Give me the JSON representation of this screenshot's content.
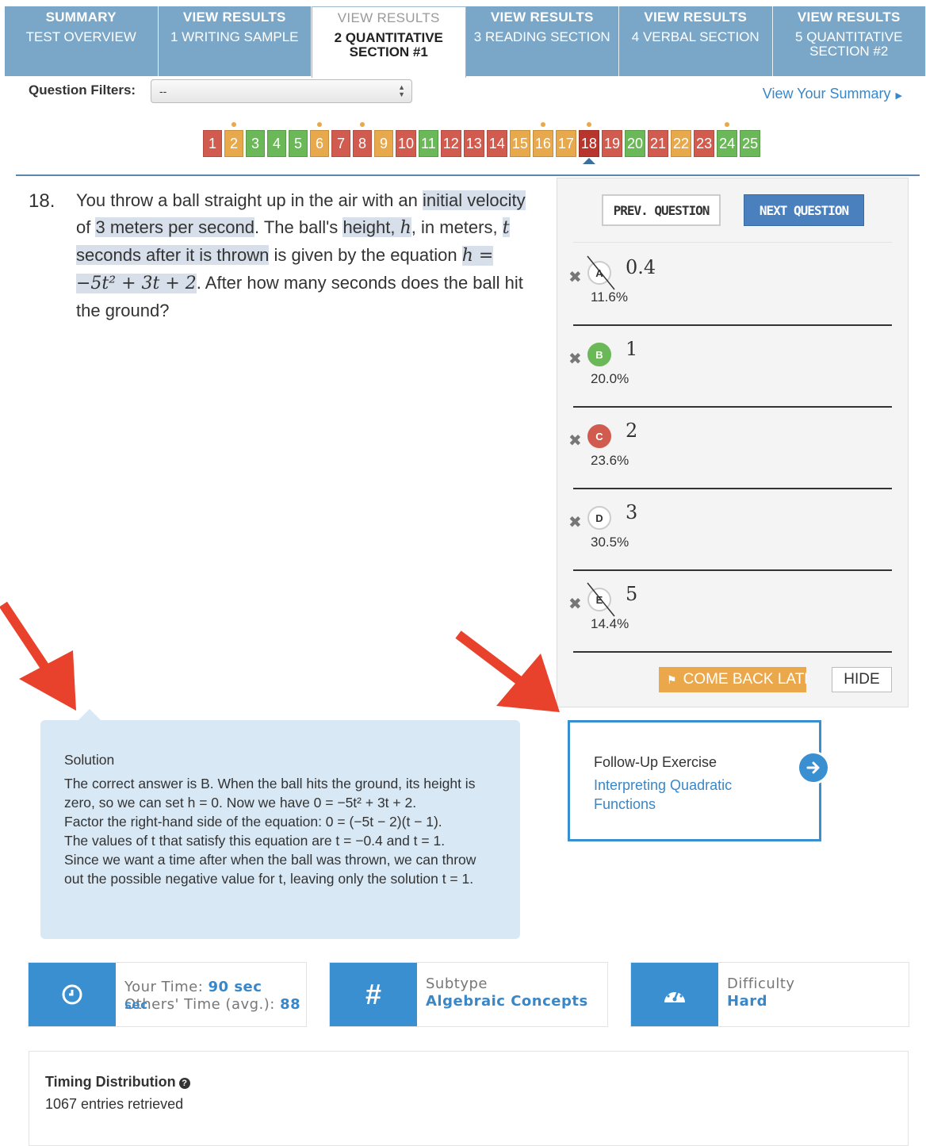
{
  "tabs": [
    {
      "line1": "SUMMARY",
      "line2": "TEST OVERVIEW"
    },
    {
      "line1": "VIEW RESULTS",
      "line2": "1 WRITING SAMPLE"
    },
    {
      "line1": "VIEW RESULTS",
      "line2": "2 QUANTITATIVE SECTION #1",
      "active": true
    },
    {
      "line1": "VIEW RESULTS",
      "line2": "3 READING SECTION"
    },
    {
      "line1": "VIEW RESULTS",
      "line2": "4 VERBAL SECTION"
    },
    {
      "line1": "VIEW RESULTS",
      "line2": "5 QUANTITATIVE SECTION #2"
    }
  ],
  "filters": {
    "label": "Question Filters:",
    "selected": "--"
  },
  "summary_link": "View Your Summary",
  "pager": [
    {
      "n": "1",
      "s": "r"
    },
    {
      "n": "2",
      "s": "o",
      "dot": true
    },
    {
      "n": "3",
      "s": "g"
    },
    {
      "n": "4",
      "s": "g"
    },
    {
      "n": "5",
      "s": "g"
    },
    {
      "n": "6",
      "s": "o",
      "dot": true
    },
    {
      "n": "7",
      "s": "r"
    },
    {
      "n": "8",
      "s": "r",
      "dot": true
    },
    {
      "n": "9",
      "s": "o"
    },
    {
      "n": "10",
      "s": "r"
    },
    {
      "n": "11",
      "s": "g"
    },
    {
      "n": "12",
      "s": "r"
    },
    {
      "n": "13",
      "s": "r"
    },
    {
      "n": "14",
      "s": "r"
    },
    {
      "n": "15",
      "s": "o"
    },
    {
      "n": "16",
      "s": "o",
      "dot": true
    },
    {
      "n": "17",
      "s": "o"
    },
    {
      "n": "18",
      "s": "cur",
      "dot": true,
      "current": true
    },
    {
      "n": "19",
      "s": "r"
    },
    {
      "n": "20",
      "s": "g"
    },
    {
      "n": "21",
      "s": "r"
    },
    {
      "n": "22",
      "s": "o"
    },
    {
      "n": "23",
      "s": "r"
    },
    {
      "n": "24",
      "s": "g",
      "dot": true
    },
    {
      "n": "25",
      "s": "g"
    }
  ],
  "question": {
    "number": "18.",
    "p1": "You throw a ball straight up in the air with an ",
    "h1": "initial velocity",
    "p2": " of ",
    "h2": "3 meters per second",
    "p3": ". The ball's ",
    "h3": "height, ",
    "hvar": "h",
    "p4": ", in meters, ",
    "tvar": "t",
    "h4": " seconds after it is thrown",
    "p5": " is given by the equation ",
    "eq": "h = −5t² + 3t + 2",
    "p6": ". After how many seconds does the ball hit the ground?"
  },
  "buttons": {
    "prev": "PREV. QUESTION",
    "next": "NEXT QUESTION",
    "later": "COME BACK LATER",
    "hide": "HIDE"
  },
  "choices": [
    {
      "letter": "A",
      "value": "0.4",
      "pct": "11.6%",
      "state": "struck"
    },
    {
      "letter": "B",
      "value": "1",
      "pct": "20.0%",
      "state": "correct"
    },
    {
      "letter": "C",
      "value": "2",
      "pct": "23.6%",
      "state": "selected-wrong"
    },
    {
      "letter": "D",
      "value": "3",
      "pct": "30.5%",
      "state": "none"
    },
    {
      "letter": "E",
      "value": "5",
      "pct": "14.4%",
      "state": "struck"
    }
  ],
  "solution": {
    "title": "Solution",
    "l1": "The correct answer is B. When the ball hits the ground, its height is zero, so we can set h = 0. Now we have 0 = −5t² + 3t + 2.",
    "l2": "Factor the right-hand side of the equation: 0 = (−5t − 2)(t − 1).",
    "l3": "The values of t that satisfy this equation are t = −0.4 and t = 1.",
    "l4": "Since we want a time after when the ball was thrown, we can throw out the possible negative value for t, leaving only the solution t = 1."
  },
  "followup": {
    "title": "Follow-Up Exercise",
    "link": "Interpreting Quadratic Functions"
  },
  "stats": {
    "time_label": "Your Time:",
    "time_value": "90 sec",
    "others_label": "Others' Time (avg.):",
    "others_value": "88",
    "others_unit": "sec",
    "subtype_label": "Subtype",
    "subtype_value": "Algebraic Concepts",
    "difficulty_label": "Difficulty",
    "difficulty_value": "Hard"
  },
  "timing": {
    "title": "Timing Distribution",
    "count": "1067 entries retrieved"
  },
  "colors": {
    "accent": "#3a8fd0",
    "tab": "#7aa7c7",
    "correct": "#6bb859",
    "wrong": "#d15b4f",
    "skipped": "#e8a94c",
    "arrow": "#e8412c"
  }
}
